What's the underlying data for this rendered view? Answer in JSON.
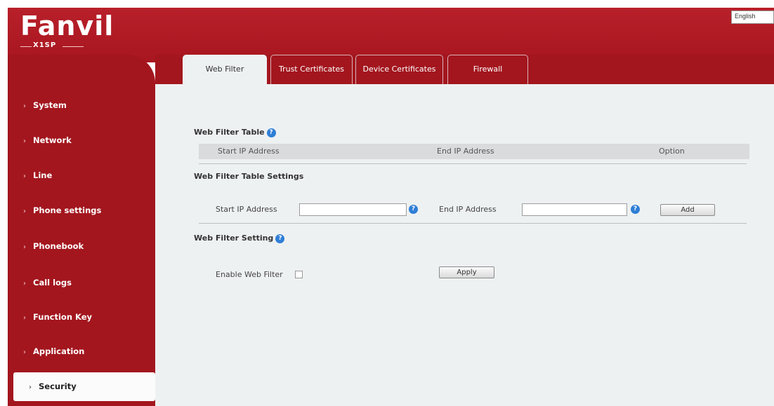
{
  "header": {
    "logo_text": "Fanvil",
    "model": "X1SP",
    "language": "English"
  },
  "sidebar": {
    "items": [
      {
        "label": "System",
        "active": false
      },
      {
        "label": "Network",
        "active": false
      },
      {
        "label": "Line",
        "active": false
      },
      {
        "label": "Phone settings",
        "active": false
      },
      {
        "label": "Phonebook",
        "active": false
      },
      {
        "label": "Call logs",
        "active": false
      },
      {
        "label": "Function Key",
        "active": false
      },
      {
        "label": "Application",
        "active": false
      },
      {
        "label": "Security",
        "active": true
      }
    ]
  },
  "tabs": [
    {
      "label": "Web Filter",
      "active": true
    },
    {
      "label": "Trust Certificates",
      "active": false
    },
    {
      "label": "Device Certificates",
      "active": false
    },
    {
      "label": "Firewall",
      "active": false
    }
  ],
  "web_filter_table": {
    "title": "Web Filter Table",
    "columns": [
      "Start IP Address",
      "End IP Address",
      "Option"
    ]
  },
  "table_settings": {
    "title": "Web Filter Table Settings",
    "start_ip_label": "Start IP Address",
    "start_ip_value": "",
    "end_ip_label": "End IP Address",
    "end_ip_value": "",
    "add_label": "Add"
  },
  "filter_setting": {
    "title": "Web Filter Setting",
    "enable_label": "Enable Web Filter",
    "enable_checked": false,
    "apply_label": "Apply"
  },
  "icons": {
    "help": "help-icon",
    "chevron": "chevron-right-icon"
  },
  "colors": {
    "brand_red": "#a3161e",
    "help_blue": "#2f7fd6",
    "panel_bg": "#eef1f2"
  }
}
